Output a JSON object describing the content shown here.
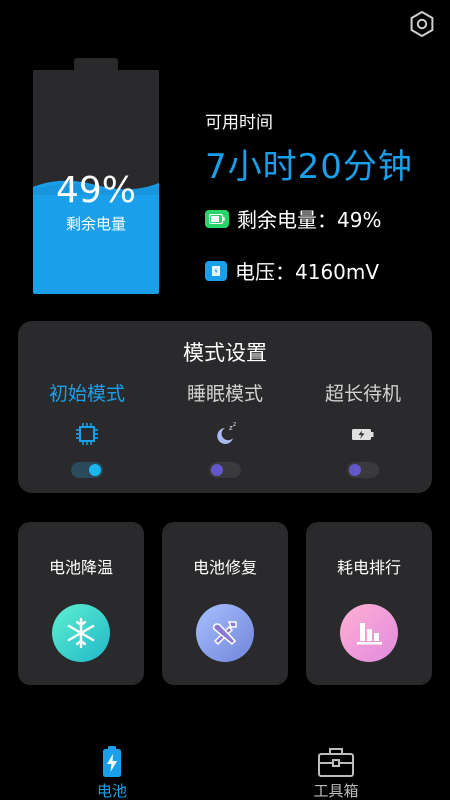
{
  "battery": {
    "percent_text": "49%",
    "remain_label": "剩余电量",
    "level": 0.49,
    "fill_color": "#1aa0ea"
  },
  "info": {
    "avail_label": "可用时间",
    "avail_time": "7小时20分钟",
    "remain_text": "剩余电量：49%",
    "voltage_text": "电压：4160mV",
    "accent_color": "#1aa0ea"
  },
  "mode": {
    "title": "模式设置",
    "modes": [
      {
        "label": "初始模式",
        "icon": "cpu-chip-icon",
        "active": true
      },
      {
        "label": "睡眠模式",
        "icon": "moon-sleep-icon",
        "active": false
      },
      {
        "label": "超长待机",
        "icon": "battery-charging-icon",
        "active": false
      }
    ]
  },
  "tools": [
    {
      "label": "电池降温",
      "icon": "snowflake-icon"
    },
    {
      "label": "电池修复",
      "icon": "wrench-hammer-icon"
    },
    {
      "label": "耗电排行",
      "icon": "bar-chart-icon"
    }
  ],
  "nav": {
    "battery_label": "电池",
    "toolbox_label": "工具箱"
  }
}
